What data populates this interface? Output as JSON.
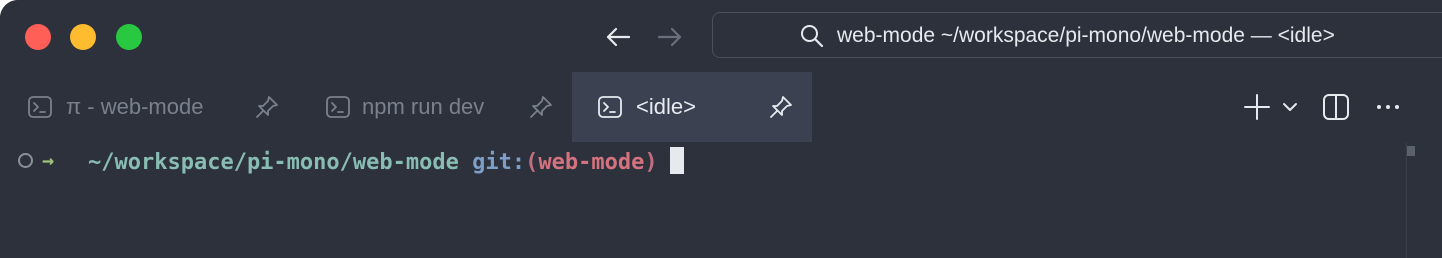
{
  "window": {
    "traffic_lights": [
      {
        "name": "close",
        "color": "#ff5f57"
      },
      {
        "name": "minimize",
        "color": "#febc2e"
      },
      {
        "name": "zoom",
        "color": "#28c840"
      }
    ]
  },
  "navigation": {
    "back_icon": "arrow-left-icon",
    "forward_icon": "arrow-right-icon"
  },
  "search": {
    "icon": "search-icon",
    "text": "web-mode ~/workspace/pi-mono/web-mode — <idle>"
  },
  "tabs": [
    {
      "label": "π - web-mode",
      "icon": "terminal-icon",
      "pin_icon": "pin-icon",
      "active": false
    },
    {
      "label": "npm run dev",
      "icon": "terminal-icon",
      "pin_icon": "pin-icon",
      "active": false
    },
    {
      "label": "<idle>",
      "icon": "terminal-icon",
      "pin_icon": "pin-icon",
      "active": true
    }
  ],
  "tabbar_actions": {
    "new_tab_icon": "plus-icon",
    "new_tab_menu_icon": "chevron-down-icon",
    "split_icon": "split-pane-icon",
    "more_icon": "more-horizontal-icon"
  },
  "terminal": {
    "prompt_symbol": "→",
    "cwd": "~/workspace/pi-mono/web-mode",
    "git_prefix": "git:",
    "paren_open": "(",
    "branch": "web-mode",
    "paren_close": ")"
  },
  "colors": {
    "background": "#2c313c",
    "active_tab": "#3b4150",
    "path": "#89bdb3",
    "git": "#7d9ec7",
    "branch": "#d4737f",
    "arrow": "#9ec07a"
  }
}
